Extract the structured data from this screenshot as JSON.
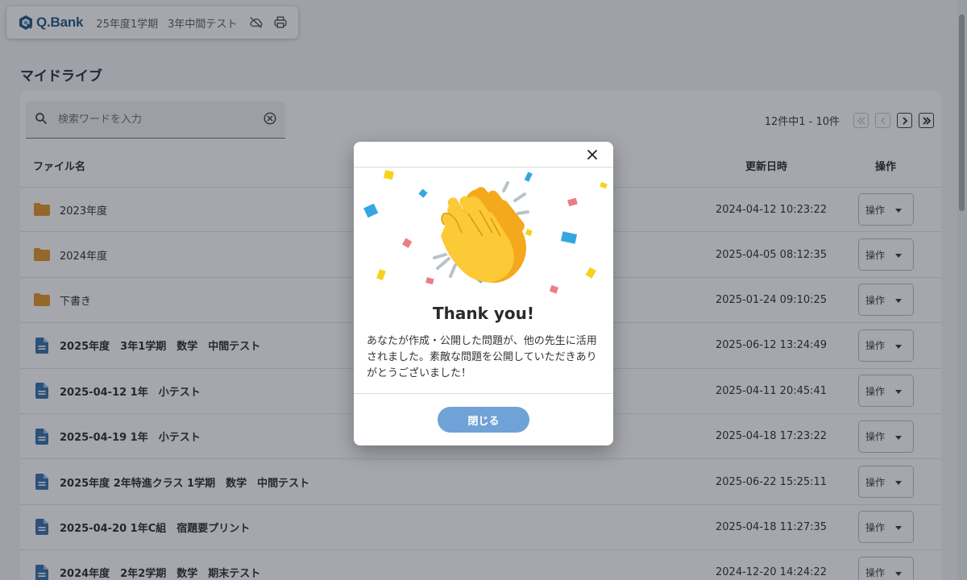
{
  "header": {
    "logo_text": "Q.Bank",
    "term": "25年度1学期",
    "test": "3年中間テスト",
    "icons": [
      "cloud-off-icon",
      "printer-icon"
    ]
  },
  "page": {
    "title": "マイドライブ"
  },
  "search": {
    "placeholder": "検索ワードを入力",
    "value": ""
  },
  "pagination": {
    "summary": "12件中1 - 10件"
  },
  "table": {
    "columns": {
      "name": "ファイル名",
      "updated": "更新日時",
      "actions": "操作"
    },
    "rows": [
      {
        "type": "folder",
        "name": "2023年度",
        "updated": "2024-04-12 10:23:22",
        "action": "操作"
      },
      {
        "type": "folder",
        "name": "2024年度",
        "updated": "2025-04-05 08:12:35",
        "action": "操作"
      },
      {
        "type": "folder",
        "name": "下書き",
        "updated": "2025-01-24 09:10:25",
        "action": "操作"
      },
      {
        "type": "file",
        "name": "2025年度　3年1学期　数学　中間テスト",
        "updated": "2025-06-12 13:24:49",
        "action": "操作"
      },
      {
        "type": "file",
        "name": "2025-04-12 1年　小テスト",
        "updated": "2025-04-11 20:45:41",
        "action": "操作"
      },
      {
        "type": "file",
        "name": "2025-04-19 1年　小テスト",
        "updated": "2025-04-18 17:23:22",
        "action": "操作"
      },
      {
        "type": "file",
        "name": "2025年度 2年特進クラス 1学期　数学　中間テスト",
        "updated": "2025-06-22 15:25:11",
        "action": "操作"
      },
      {
        "type": "file",
        "name": "2025-04-20 1年C組　宿題要プリント",
        "updated": "2025-04-18 11:27:35",
        "action": "操作"
      },
      {
        "type": "file",
        "name": "2024年度　2年2学期　数学　期末テスト",
        "updated": "2024-12-20 14:24:22",
        "action": "操作"
      }
    ]
  },
  "modal": {
    "title": "Thank you!",
    "message": "あなたが作成・公開した問題が、他の先生に活用されました。素敵な問題を公開していただきありがとうございました！",
    "close_button": "閉じる"
  },
  "colors": {
    "brand": "#1d4f7a",
    "folder": "#e3921f",
    "file": "#2d6ca6",
    "button": "#6fa2d6",
    "overlay": "rgba(40,45,60,0.42)"
  }
}
